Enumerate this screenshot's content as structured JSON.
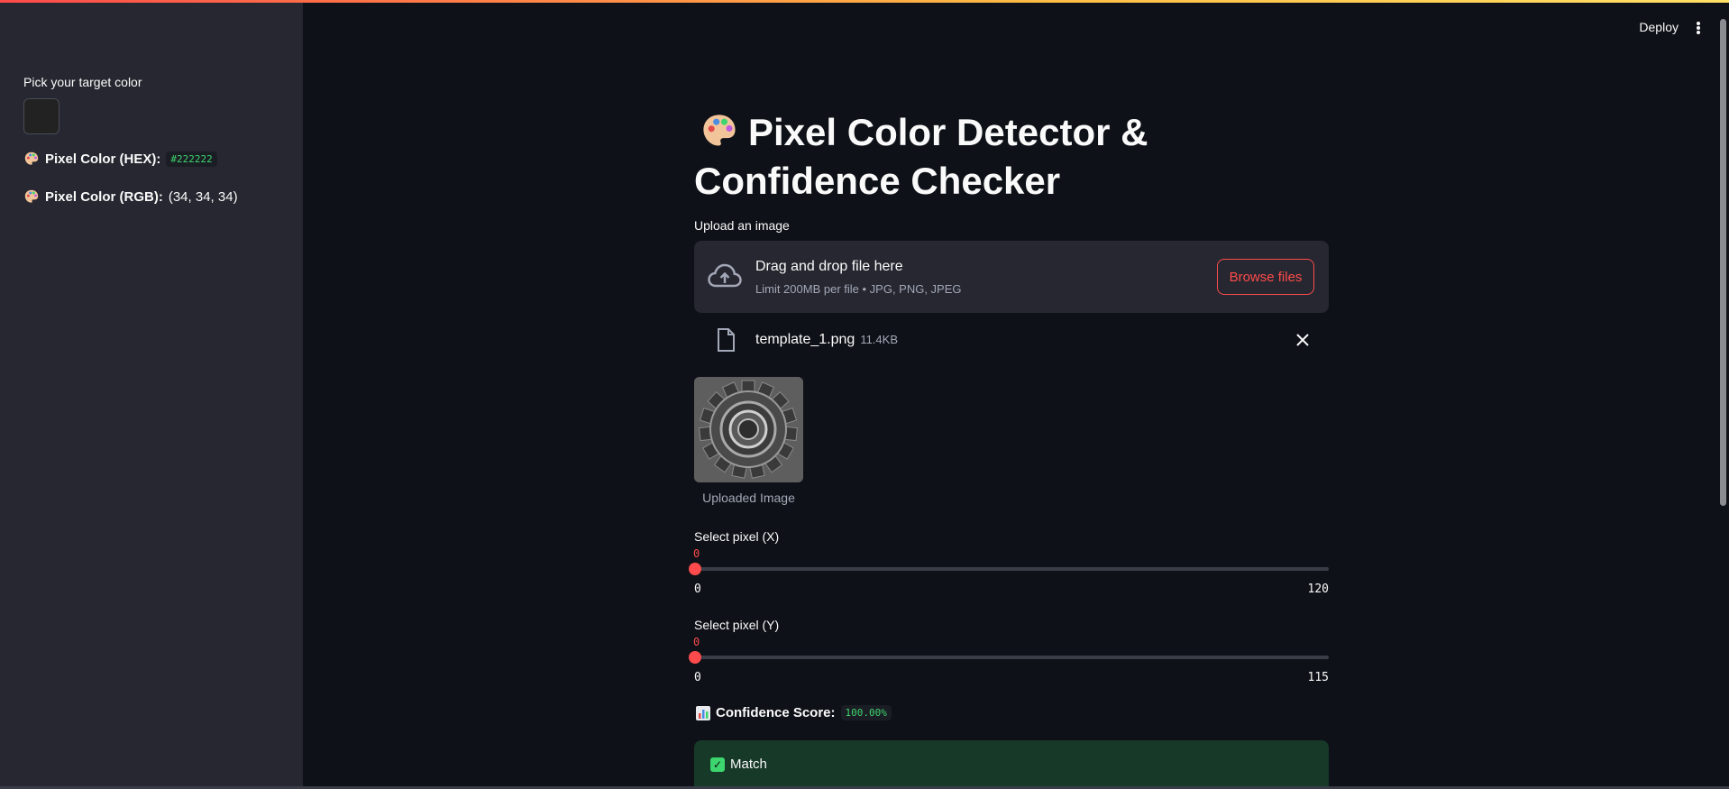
{
  "header": {
    "deploy_label": "Deploy"
  },
  "sidebar": {
    "color_label": "Pick your target color",
    "swatch_color": "#222222",
    "hex_label": "Pixel Color (HEX):",
    "hex_value": "#222222",
    "rgb_label": "Pixel Color (RGB):",
    "rgb_value": "(34, 34, 34)"
  },
  "main": {
    "title_line1": "Pixel Color Detector &",
    "title_line2": "Confidence Checker",
    "upload_label": "Upload an image",
    "dropzone_title": "Drag and drop file here",
    "dropzone_sub": "Limit 200MB per file • JPG, PNG, JPEG",
    "browse_label": "Browse files",
    "file_name": "template_1.png",
    "file_size": "11.4KB",
    "image_caption": "Uploaded Image",
    "slider_x": {
      "label": "Select pixel (X)",
      "value": "0",
      "min": "0",
      "max": "120"
    },
    "slider_y": {
      "label": "Select pixel (Y)",
      "value": "0",
      "min": "0",
      "max": "115"
    },
    "confidence_label": "Confidence Score:",
    "confidence_value": "100.00%",
    "match_label": "Match"
  },
  "colors": {
    "accent": "#ff4b4b",
    "success": "#3dd56d",
    "sidebar_bg": "#262730",
    "main_bg": "#0e1117"
  }
}
